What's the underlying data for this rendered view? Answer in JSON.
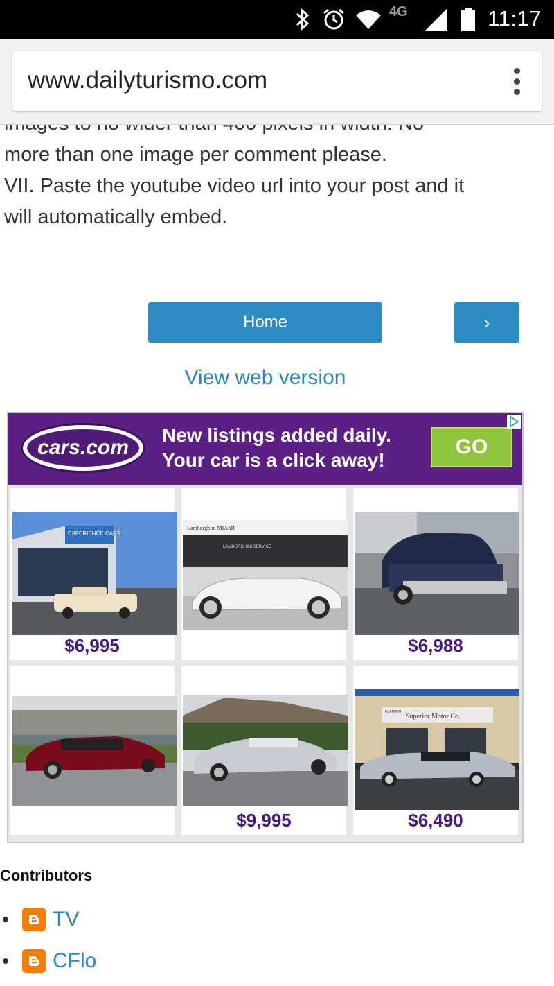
{
  "status_bar": {
    "time": "11:17",
    "network": "4G",
    "icons": [
      "bluetooth-icon",
      "alarm-icon",
      "wifi-icon",
      "signal-icon",
      "battery-icon"
    ]
  },
  "browser": {
    "url": "www.dailyturismo.com",
    "menu_icon": "overflow-menu-icon"
  },
  "rules_text": {
    "line_partial": "images to no wider than 400 pixels in width. No",
    "line_1": "more than one image per comment please.",
    "line_2": "VII. Paste the youtube video url into your post and it",
    "line_3": "will automatically embed."
  },
  "nav": {
    "home_label": "Home",
    "next_label": "›",
    "web_version_label": "View web version"
  },
  "ad": {
    "logo_text": "cars.com",
    "tagline_1": "New listings added daily.",
    "tagline_2": "Your car is a click away!",
    "go_label": "GO",
    "listings": [
      {
        "price": "$6,995",
        "image": "white-cadillac-eldorado-at-dealer"
      },
      {
        "price": "",
        "image": "silver-mercedes-sl-convertible"
      },
      {
        "price": "$6,988",
        "image": "dark-blue-cadillac-sedan"
      },
      {
        "price": "",
        "image": "red-lincoln-mark-viii"
      },
      {
        "price": "$9,995",
        "image": "silver-lincoln-continental-mark"
      },
      {
        "price": "$6,490",
        "image": "silver-lincoln-at-superior-motor-co"
      }
    ],
    "dealer_sign_1": "EXPERIENCE CARS",
    "dealer_sign_2": "Lamborghini MIAMI",
    "dealer_sign_3": "LAMBORGHINI SERVICE",
    "dealer_sign_4": "KLAMATH",
    "dealer_sign_5": "Superior Motor Co."
  },
  "contributors": {
    "title": "Contributors",
    "items": [
      {
        "name": "TV",
        "icon": "blogger-icon"
      },
      {
        "name": "CFlo",
        "icon": "blogger-icon"
      }
    ]
  },
  "colors": {
    "link_blue": "#2b86c1",
    "button_blue": "#2d8cc3",
    "ad_purple": "#5b1f86",
    "price_purple": "#4a1a7a",
    "go_green": "#8fc43d",
    "blogger_orange": "#f57d00"
  }
}
